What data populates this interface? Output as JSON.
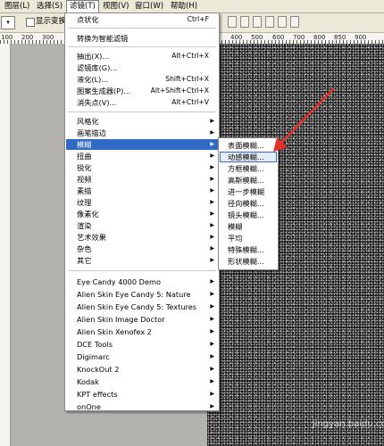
{
  "colors": {
    "menu_highlight": "#316ac5",
    "arrow": "#e8302a",
    "canvas_noise_bg": "#1a1a1a"
  },
  "menubar": {
    "items": [
      {
        "label": "图层(L)"
      },
      {
        "label": "选择(S)"
      },
      {
        "label": "滤镜(T)"
      },
      {
        "label": "视图(V)"
      },
      {
        "label": "窗口(W)"
      },
      {
        "label": "帮助(H)"
      }
    ]
  },
  "toolbar": {
    "dropdown_arrow": "▾",
    "show_transform_label": "显示变换"
  },
  "ruler": {
    "labels": [
      "100",
      "200",
      "300",
      "400",
      "500",
      "600",
      "700",
      "800",
      "850",
      "900"
    ]
  },
  "filter_menu": {
    "items": [
      {
        "label": "点状化",
        "shortcut": "Ctrl+F"
      },
      {
        "label": "转换为智能滤镜"
      },
      {
        "label": "抽出(X)...",
        "shortcut": "Alt+Ctrl+X"
      },
      {
        "label": "滤镜库(G)..."
      },
      {
        "label": "液化(L)...",
        "shortcut": "Shift+Ctrl+X"
      },
      {
        "label": "图案生成器(P)...",
        "shortcut": "Alt+Shift+Ctrl+X"
      },
      {
        "label": "消失点(V)...",
        "shortcut": "Alt+Ctrl+V"
      },
      {
        "label": "风格化"
      },
      {
        "label": "画笔描边"
      },
      {
        "label": "模糊"
      },
      {
        "label": "扭曲"
      },
      {
        "label": "锐化"
      },
      {
        "label": "视频"
      },
      {
        "label": "素描"
      },
      {
        "label": "纹理"
      },
      {
        "label": "像素化"
      },
      {
        "label": "渲染"
      },
      {
        "label": "艺术效果"
      },
      {
        "label": "杂色"
      },
      {
        "label": "其它"
      },
      {
        "label": "Eye Candy 4000 Demo"
      },
      {
        "label": "Alien Skin Eye Candy 5: Nature"
      },
      {
        "label": "Alien Skin Eye Candy 5: Textures"
      },
      {
        "label": "Alien Skin Image Doctor"
      },
      {
        "label": "Alien Skin Xenofex 2"
      },
      {
        "label": "DCE Tools"
      },
      {
        "label": "Digimarc"
      },
      {
        "label": "KnockOut 2"
      },
      {
        "label": "Kodak"
      },
      {
        "label": "KPT effects"
      },
      {
        "label": "onOne"
      }
    ]
  },
  "blur_submenu": {
    "items": [
      {
        "label": "表面模糊..."
      },
      {
        "label": "动感模糊..."
      },
      {
        "label": "方框模糊..."
      },
      {
        "label": "高斯模糊..."
      },
      {
        "label": "进一步模糊"
      },
      {
        "label": "径向模糊..."
      },
      {
        "label": "镜头模糊..."
      },
      {
        "label": "模糊"
      },
      {
        "label": "平均"
      },
      {
        "label": "特殊模糊..."
      },
      {
        "label": "形状模糊..."
      }
    ]
  },
  "watermark": {
    "text": "jingyan.baidu.com"
  }
}
